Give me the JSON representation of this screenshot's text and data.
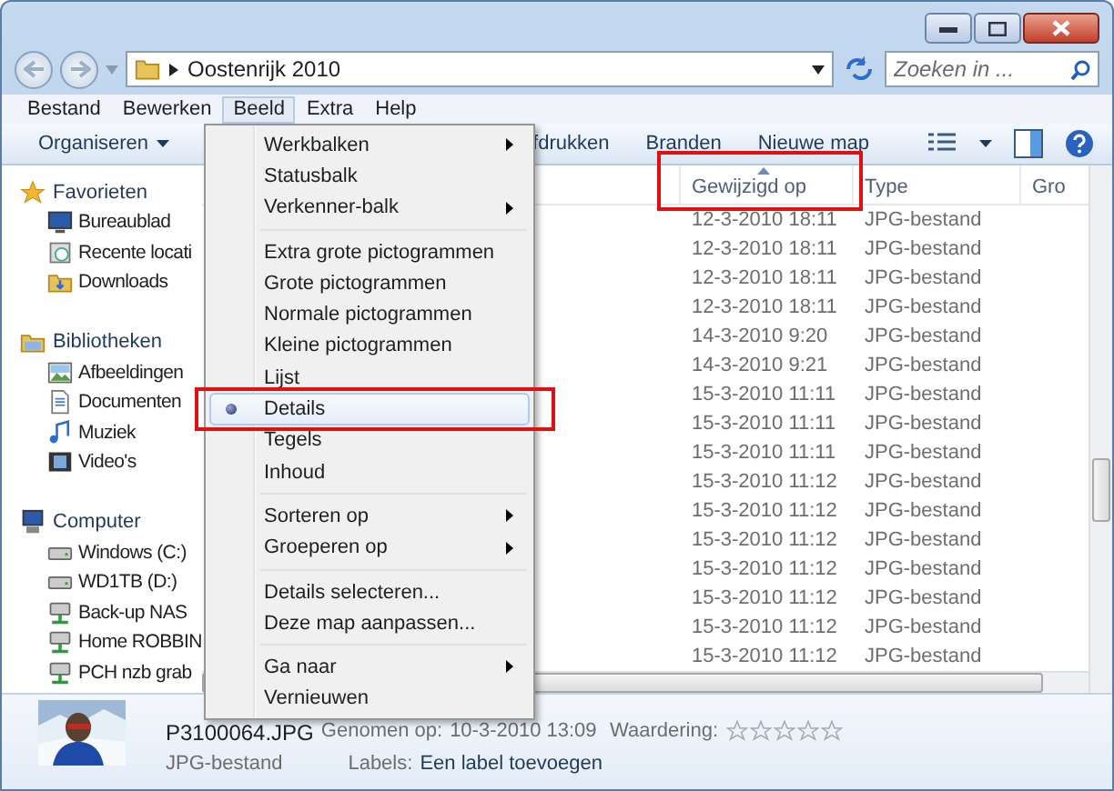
{
  "address": {
    "path": "Oostenrijk 2010",
    "search_placeholder": "Zoeken in ..."
  },
  "menubar": [
    {
      "label": "Bestand",
      "open": false
    },
    {
      "label": "Bewerken",
      "open": false
    },
    {
      "label": "Beeld",
      "open": true
    },
    {
      "label": "Extra",
      "open": false
    },
    {
      "label": "Help",
      "open": false
    }
  ],
  "toolbar": [
    {
      "label": "Organiseren",
      "dropdown": true
    },
    {
      "label": "fdrukken",
      "dropdown": false
    },
    {
      "label": "Branden",
      "dropdown": false
    },
    {
      "label": "Nieuwe map",
      "dropdown": false
    }
  ],
  "sidebar": [
    {
      "label": "Favorieten",
      "children": [
        {
          "label": "Bureaublad"
        },
        {
          "label": "Recente locati"
        },
        {
          "label": "Downloads"
        }
      ]
    },
    {
      "label": "Bibliotheken",
      "children": [
        {
          "label": "Afbeeldingen"
        },
        {
          "label": "Documenten"
        },
        {
          "label": "Muziek"
        },
        {
          "label": "Video's"
        }
      ]
    },
    {
      "label": "Computer",
      "children": [
        {
          "label": "Windows (C:)"
        },
        {
          "label": "WD1TB (D:)"
        },
        {
          "label": "Back-up NAS"
        },
        {
          "label": "Home ROBBIN"
        },
        {
          "label": "PCH nzb grab"
        }
      ]
    }
  ],
  "table": {
    "columns": [
      {
        "label": "Gewijzigd op",
        "sorted": true,
        "annotated": true
      },
      {
        "label": "Type",
        "sorted": false,
        "annotated": false
      },
      {
        "label": "Gro",
        "sorted": false,
        "annotated": false
      }
    ],
    "rows": [
      [
        "12-3-2010 18:11",
        "JPG-bestand"
      ],
      [
        "12-3-2010 18:11",
        "JPG-bestand"
      ],
      [
        "12-3-2010 18:11",
        "JPG-bestand"
      ],
      [
        "12-3-2010 18:11",
        "JPG-bestand"
      ],
      [
        "14-3-2010 9:20",
        "JPG-bestand"
      ],
      [
        "14-3-2010 9:21",
        "JPG-bestand"
      ],
      [
        "15-3-2010 11:11",
        "JPG-bestand"
      ],
      [
        "15-3-2010 11:11",
        "JPG-bestand"
      ],
      [
        "15-3-2010 11:11",
        "JPG-bestand"
      ],
      [
        "15-3-2010 11:12",
        "JPG-bestand"
      ],
      [
        "15-3-2010 11:12",
        "JPG-bestand"
      ],
      [
        "15-3-2010 11:12",
        "JPG-bestand"
      ],
      [
        "15-3-2010 11:12",
        "JPG-bestand"
      ],
      [
        "15-3-2010 11:12",
        "JPG-bestand"
      ],
      [
        "15-3-2010 11:12",
        "JPG-bestand"
      ],
      [
        "15-3-2010 11:12",
        "JPG-bestand"
      ]
    ]
  },
  "view_menu": {
    "groups": [
      [
        {
          "label": "Werkbalken",
          "submenu": true,
          "selected": false,
          "annotated": false
        },
        {
          "label": "Statusbalk",
          "submenu": false,
          "selected": false,
          "annotated": false
        },
        {
          "label": "Verkenner-balk",
          "submenu": true,
          "selected": false,
          "annotated": false
        }
      ],
      [
        {
          "label": "Extra grote pictogrammen",
          "submenu": false,
          "selected": false,
          "annotated": false
        },
        {
          "label": "Grote pictogrammen",
          "submenu": false,
          "selected": false,
          "annotated": false
        },
        {
          "label": "Normale pictogrammen",
          "submenu": false,
          "selected": false,
          "annotated": false
        },
        {
          "label": "Kleine pictogrammen",
          "submenu": false,
          "selected": false,
          "annotated": false
        },
        {
          "label": "Lijst",
          "submenu": false,
          "selected": false,
          "annotated": false
        },
        {
          "label": "Details",
          "submenu": false,
          "selected": true,
          "annotated": true
        },
        {
          "label": "Tegels",
          "submenu": false,
          "selected": false,
          "annotated": false
        },
        {
          "label": "Inhoud",
          "submenu": false,
          "selected": false,
          "annotated": false
        }
      ],
      [
        {
          "label": "Sorteren op",
          "submenu": true,
          "selected": false,
          "annotated": false
        },
        {
          "label": "Groeperen op",
          "submenu": true,
          "selected": false,
          "annotated": false
        }
      ],
      [
        {
          "label": "Details selecteren...",
          "submenu": false,
          "selected": false,
          "annotated": false
        },
        {
          "label": "Deze map aanpassen...",
          "submenu": false,
          "selected": false,
          "annotated": false
        }
      ],
      [
        {
          "label": "Ga naar",
          "submenu": true,
          "selected": false,
          "annotated": false
        },
        {
          "label": "Vernieuwen",
          "submenu": false,
          "selected": false,
          "annotated": false
        }
      ]
    ]
  },
  "details_pane": {
    "filename": "P3100064.JPG",
    "taken_label": "Genomen op:",
    "taken_value": "10-3-2010 13:09",
    "type": "JPG-bestand",
    "labels_label": "Labels:",
    "labels_value": "Een label toevoegen",
    "rating_label": "Waardering:",
    "stars": 0
  }
}
